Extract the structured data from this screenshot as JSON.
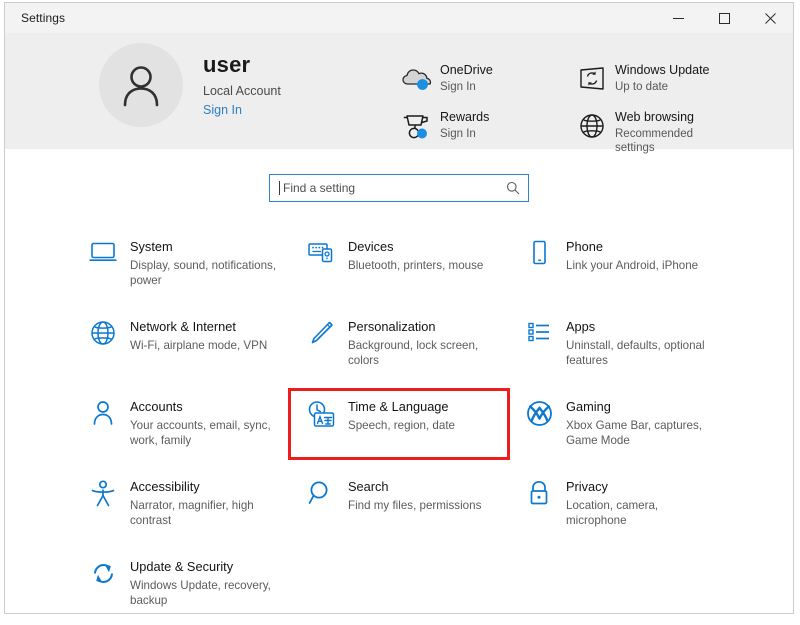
{
  "window": {
    "title": "Settings",
    "controls": [
      {
        "name": "minimize-button",
        "label": "Minimize"
      },
      {
        "name": "maximize-button",
        "label": "Maximize"
      },
      {
        "name": "close-button",
        "label": "Close"
      }
    ]
  },
  "account": {
    "avatar_icon": "person-icon",
    "name": "user",
    "type": "Local Account",
    "sign_in": "Sign In"
  },
  "status_items": [
    {
      "icon": "onedrive-cloud-icon",
      "title": "OneDrive",
      "subtitle": "Sign In"
    },
    {
      "icon": "windows-update-refresh-icon",
      "title": "Windows Update",
      "subtitle": "Up to date"
    },
    {
      "icon": "rewards-trophy-icon",
      "title": "Rewards",
      "subtitle": "Sign In"
    },
    {
      "icon": "globe-icon",
      "title": "Web browsing",
      "subtitle": "Recommended settings"
    }
  ],
  "search": {
    "placeholder": "Find a setting",
    "value": "",
    "icon": "search-magnifier-icon",
    "focused": true,
    "accent": "#2f81cd"
  },
  "categories": [
    {
      "icon": "monitor-icon",
      "title": "System",
      "subtitle": "Display, sound, notifications, power",
      "highlighted": false
    },
    {
      "icon": "devices-icon",
      "title": "Devices",
      "subtitle": "Bluetooth, printers, mouse",
      "highlighted": false
    },
    {
      "icon": "phone-icon",
      "title": "Phone",
      "subtitle": "Link your Android, iPhone",
      "highlighted": false
    },
    {
      "icon": "globe-icon",
      "title": "Network & Internet",
      "subtitle": "Wi-Fi, airplane mode, VPN",
      "highlighted": false
    },
    {
      "icon": "paintbrush-icon",
      "title": "Personalization",
      "subtitle": "Background, lock screen, colors",
      "highlighted": false
    },
    {
      "icon": "apps-list-icon",
      "title": "Apps",
      "subtitle": "Uninstall, defaults, optional features",
      "highlighted": false
    },
    {
      "icon": "person-icon",
      "title": "Accounts",
      "subtitle": "Your accounts, email, sync, work, family",
      "highlighted": false
    },
    {
      "icon": "time-language-icon",
      "title": "Time & Language",
      "subtitle": "Speech, region, date",
      "highlighted": true
    },
    {
      "icon": "xbox-icon",
      "title": "Gaming",
      "subtitle": "Xbox Game Bar, captures, Game Mode",
      "highlighted": false
    },
    {
      "icon": "accessibility-icon",
      "title": "Accessibility",
      "subtitle": "Narrator, magnifier, high contrast",
      "highlighted": false
    },
    {
      "icon": "search-magnifier-icon",
      "title": "Search",
      "subtitle": "Find my files, permissions",
      "highlighted": false
    },
    {
      "icon": "lock-icon",
      "title": "Privacy",
      "subtitle": "Location, camera, microphone",
      "highlighted": false
    },
    {
      "icon": "refresh-icon",
      "title": "Update & Security",
      "subtitle": "Windows Update, recovery, backup",
      "highlighted": false
    }
  ],
  "colors": {
    "accent_blue": "#0b78d0",
    "highlight_red": "#ee1d1d",
    "header_bg": "#eeeeee",
    "titlebar_bg": "#f3f3f3"
  }
}
